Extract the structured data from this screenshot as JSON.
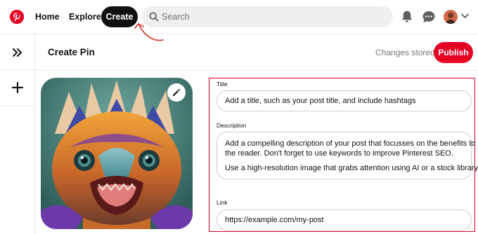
{
  "nav": {
    "home": "Home",
    "explore": "Explore",
    "create": "Create"
  },
  "search": {
    "placeholder": "Search"
  },
  "header": {
    "title": "Create Pin",
    "status": "Changes stored!",
    "publish": "Publish"
  },
  "form": {
    "title_label": "Title",
    "title_value": "Add a title, such as your post title, and include hashtags",
    "description_label": "Description",
    "description_lines": [
      "Add a compelling description of your post that focusses on the benefits to",
      "the reader. Don't forget to use keywords to improve Pinterest SEO.",
      "",
      "Use a high-resolution image that grabs attention using AI or a stock library"
    ],
    "link_label": "Link",
    "link_value": "https://example.com/my-post"
  },
  "colors": {
    "brand": "#e60023",
    "form_border": "#e0002a",
    "annotation_arrow": "#d9453a"
  },
  "icons": [
    "pinterest-logo",
    "search-icon",
    "bell-icon",
    "chat-icon",
    "chevron-down-icon",
    "expand-icon",
    "plus-icon",
    "pencil-icon"
  ]
}
